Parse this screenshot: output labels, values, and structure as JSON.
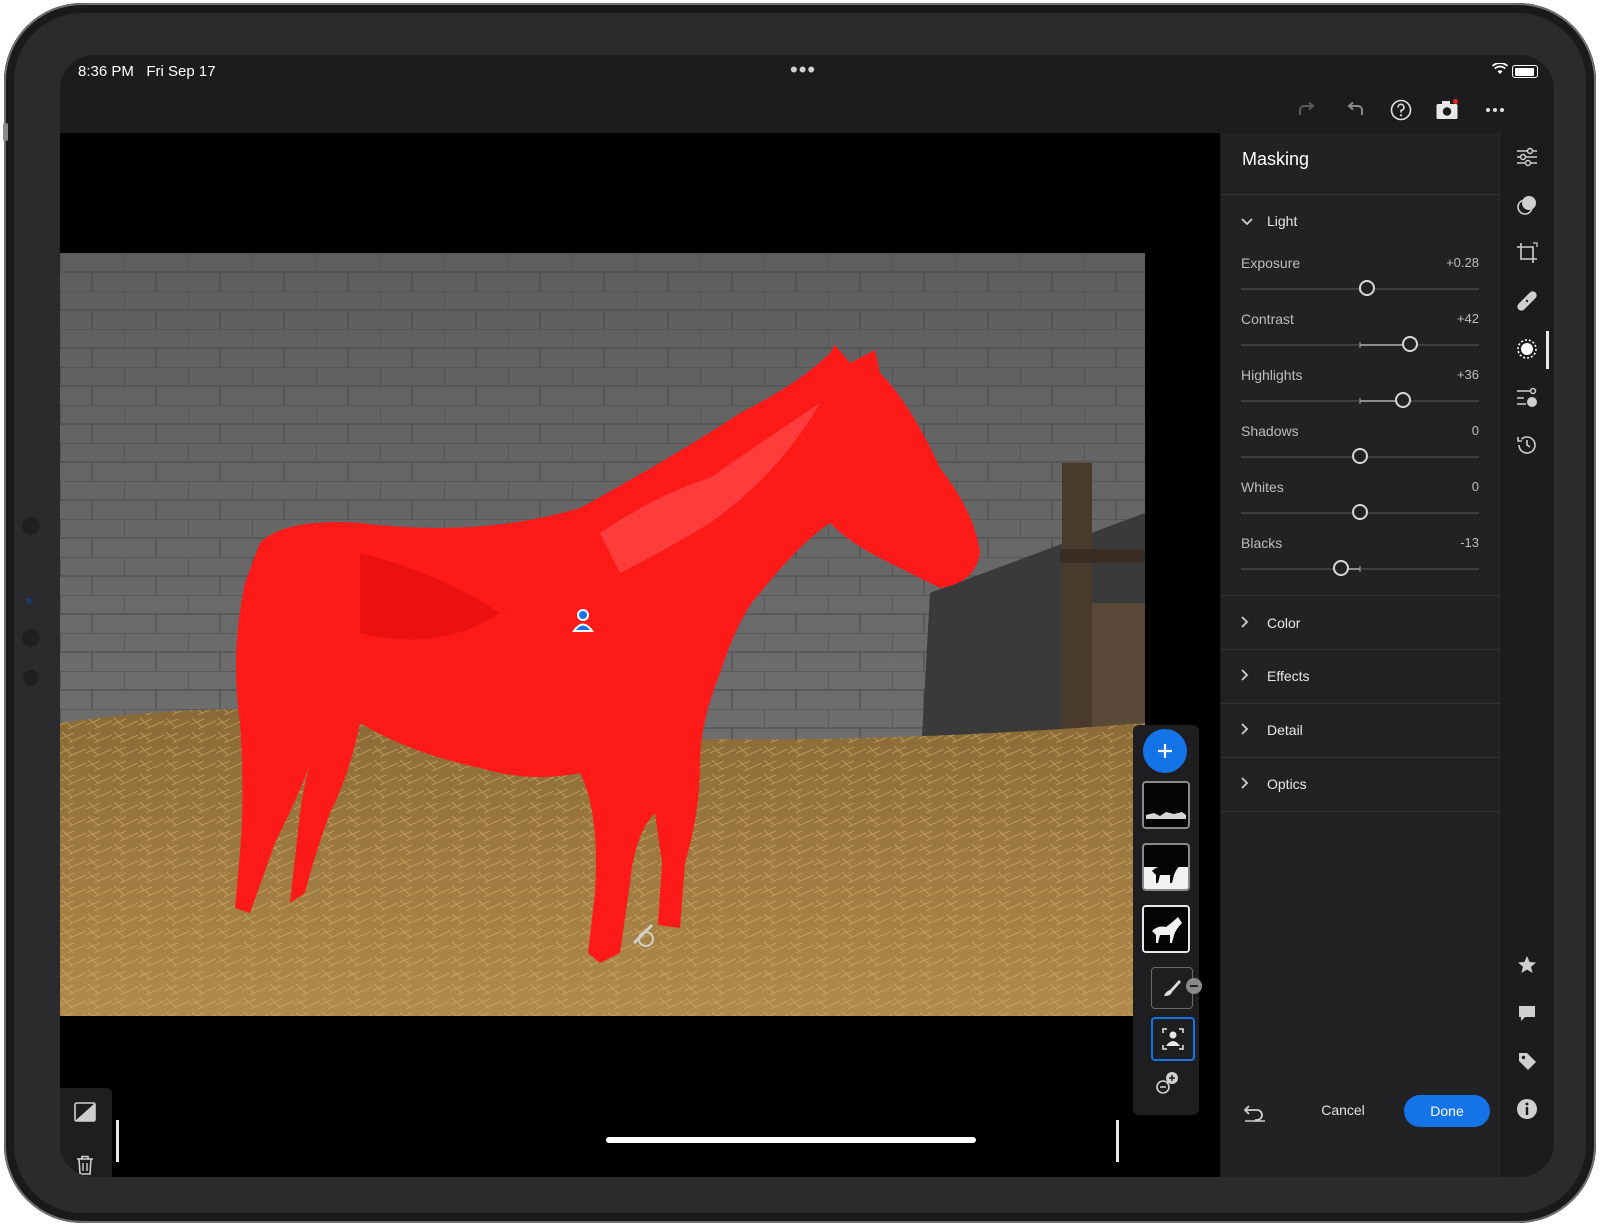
{
  "status_bar": {
    "time": "8:36 PM",
    "date": "Fri Sep 17",
    "center_dots": "•••"
  },
  "toolbar": {
    "icons": [
      "redo-icon",
      "undo-icon",
      "help-icon",
      "camera-icon",
      "more-icon"
    ]
  },
  "panel": {
    "title": "Masking",
    "light": {
      "label": "Light",
      "sliders": [
        {
          "name": "Exposure",
          "value": "+0.28",
          "level": 0.53
        },
        {
          "name": "Contrast",
          "value": "+42",
          "level": 0.71
        },
        {
          "name": "Highlights",
          "value": "+36",
          "level": 0.68
        },
        {
          "name": "Shadows",
          "value": "0",
          "level": 0.5
        },
        {
          "name": "Whites",
          "value": "0",
          "level": 0.5
        },
        {
          "name": "Blacks",
          "value": "-13",
          "level": 0.42
        }
      ]
    },
    "sections": [
      "Color",
      "Effects",
      "Detail",
      "Optics"
    ],
    "cancel_label": "Cancel",
    "done_label": "Done"
  },
  "rail_icons": [
    "edit-sliders-icon",
    "presets-icon",
    "crop-icon",
    "healing-icon",
    "masking-icon",
    "versions-icon",
    "history-icon",
    "star-icon",
    "comment-icon",
    "tag-icon",
    "info-icon"
  ],
  "colors": {
    "accent": "#1473e6",
    "mask_overlay": "#ff1a1a",
    "panel_bg": "#222224"
  }
}
